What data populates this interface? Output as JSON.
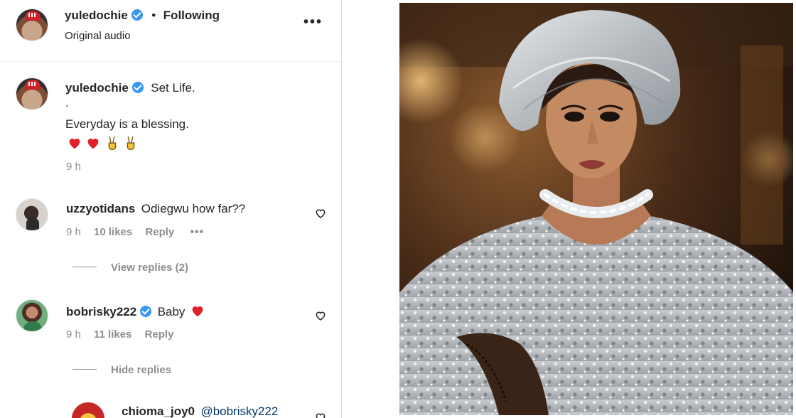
{
  "header": {
    "username": "yuledochie",
    "separator": "•",
    "follow_status": "Following",
    "audio": "Original audio",
    "more_icon": "more-horizontal-icon"
  },
  "caption": {
    "username": "yuledochie",
    "line1": "Set Life.",
    "line2": ".",
    "line3": "Everyday is a blessing.",
    "emojis": [
      "red-heart",
      "red-heart",
      "victory-hand",
      "victory-hand"
    ],
    "time": "9 h"
  },
  "comments": [
    {
      "username": "uzzyotidans",
      "text": "Odiegwu how far??",
      "time": "9 h",
      "likes": "10 likes",
      "reply_label": "Reply",
      "dots": "•••",
      "thread_toggle": "View replies (2)"
    },
    {
      "username": "bobrisky222",
      "text": "Baby",
      "emoji": "red-heart",
      "time": "9 h",
      "likes": "11 likes",
      "reply_label": "Reply",
      "thread_toggle": "Hide replies"
    }
  ],
  "reply": {
    "username": "chioma_joy0",
    "mention": "@bobrisky222"
  },
  "colors": {
    "verified": "#3897f0",
    "heart": "#ed4956",
    "muted": "#8e8e8e",
    "text": "#262626",
    "mention": "#00376b"
  }
}
